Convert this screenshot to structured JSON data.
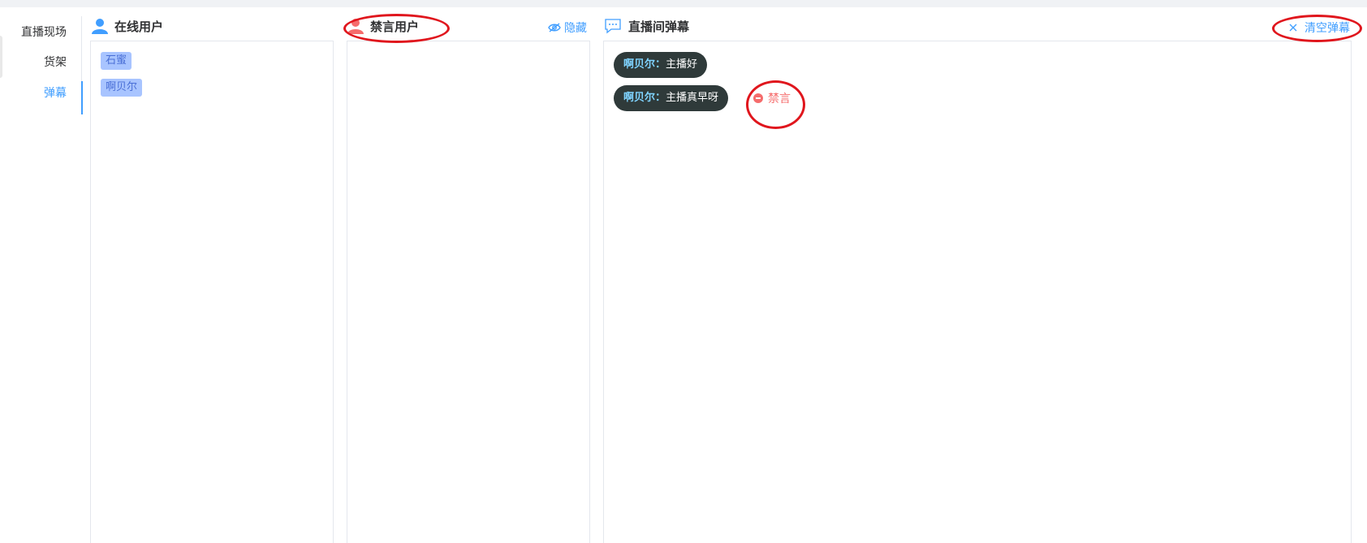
{
  "sidebar": {
    "items": [
      {
        "label": "直播现场",
        "active": false
      },
      {
        "label": "货架",
        "active": false
      },
      {
        "label": "弹幕",
        "active": true
      }
    ]
  },
  "online_users": {
    "title": "在线用户",
    "icon": "user-icon",
    "icon_color": "#409eff",
    "users": [
      "石蜜",
      "啊贝尔"
    ]
  },
  "banned_users": {
    "title": "禁言用户",
    "icon": "user-icon",
    "icon_color": "#f56c6c",
    "hide_label": "隐藏",
    "hide_icon": "eye-hidden-icon",
    "users": []
  },
  "danmu_panel": {
    "title": "直播间弹幕",
    "icon": "chat-bubble-icon",
    "clear_label": "清空弹幕",
    "clear_icon": "close-icon",
    "messages": [
      {
        "name": "啊贝尔：",
        "text": "主播好"
      },
      {
        "name": "啊贝尔：",
        "text": "主播真早呀"
      }
    ],
    "ban_label": "禁言",
    "ban_icon": "minus-circle-icon"
  },
  "colors": {
    "accent": "#409eff",
    "danger": "#f56c6c",
    "annotation": "#e0161d"
  }
}
